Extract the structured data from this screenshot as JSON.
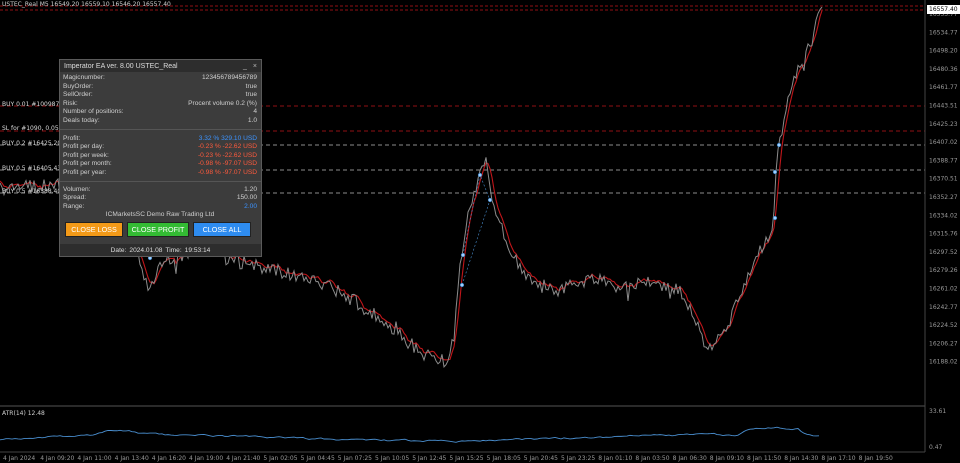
{
  "symbol_info": "USTEC_Real  M5  16549.20  16559.10  16546.20  16557.40",
  "current_price": "16557.40",
  "price_axis": [
    "16553.77",
    "16534.77",
    "16498.20",
    "16480.36",
    "16461.77",
    "16443.51",
    "16425.23",
    "16407.02",
    "16388.77",
    "16370.51",
    "16352.27",
    "16334.02",
    "16315.76",
    "16297.52",
    "16279.26",
    "16261.02",
    "16242.77",
    "16224.52",
    "16206.27",
    "16188.02"
  ],
  "time_axis": [
    "4 Jan 2024",
    "4 Jan 09:20",
    "4 Jan 11:00",
    "4 Jan 13:40",
    "4 Jan 16:20",
    "4 Jan 19:00",
    "4 Jan 21:40",
    "5 Jan 02:05",
    "5 Jan 04:45",
    "5 Jan 07:25",
    "5 Jan 10:05",
    "5 Jan 12:45",
    "5 Jan 15:25",
    "5 Jan 18:05",
    "5 Jan 20:45",
    "5 Jan 23:25",
    "8 Jan 01:10",
    "8 Jan 03:50",
    "8 Jan 06:30",
    "8 Jan 09:10",
    "8 Jan 11:50",
    "8 Jan 14:30",
    "8 Jan 17:10",
    "8 Jan 19:50"
  ],
  "order_lines": [
    {
      "label": "BUY 0.01  #1009871.20"
    },
    {
      "label": "SL for #1090, 0.05%"
    },
    {
      "label": "BUY 0.2  #16425.20"
    },
    {
      "label": "BUY 0.5  #16405.43"
    },
    {
      "label": "BUY 0.5  #16388.40"
    }
  ],
  "atr": {
    "label": "ATR(14) 12.48",
    "max": "33.61",
    "min": "0.47"
  },
  "panel": {
    "title": "Imperator EA ver. 8.00 USTEC_Real",
    "minimize": "_",
    "close": "×",
    "info": [
      {
        "label": "Magicnumber:",
        "value": "123456789456789"
      },
      {
        "label": "BuyOrder:",
        "value": "true"
      },
      {
        "label": "SellOrder:",
        "value": "true"
      },
      {
        "label": "Risk:",
        "value": "Procent volume 0.2 (%)"
      },
      {
        "label": "Number of positions:",
        "value": "4"
      },
      {
        "label": "Deals today:",
        "value": "1.0"
      }
    ],
    "profit": [
      {
        "label": "Profit:",
        "value": "3.32 % 329.10 USD",
        "tone": "pos"
      },
      {
        "label": "Profit per day:",
        "value": "-0.23 % -22.62 USD",
        "tone": "neg"
      },
      {
        "label": "Profit per week:",
        "value": "-0.23 % -22.62 USD",
        "tone": "neg"
      },
      {
        "label": "Profit per month:",
        "value": "-0.98 % -97.07 USD",
        "tone": "neg"
      },
      {
        "label": "Profit per year:",
        "value": "-0.98 % -97.07 USD",
        "tone": "neg"
      }
    ],
    "market": [
      {
        "label": "Volumen:",
        "value": "1.20",
        "tone": ""
      },
      {
        "label": "Spread:",
        "value": "150.00",
        "tone": ""
      },
      {
        "label": "Range:",
        "value": "2.00",
        "tone": "pos"
      }
    ],
    "broker": "ICMarketsSC Demo Raw Trading Ltd",
    "buttons": {
      "close_loss": "CLOSE LOSS",
      "close_profit": "CLOSE PROFIT",
      "close_all": "CLOSE ALL"
    },
    "footer": {
      "date_label": "Date:",
      "date": "2024.01.08",
      "time_label": "Time:",
      "time": "19:53:14"
    }
  },
  "colors": {
    "background": "#000000",
    "price_line": "#8a8a8a",
    "ma_line": "#c0161a",
    "order_line": "#c0161a",
    "atr_line": "#4a8fd0"
  }
}
